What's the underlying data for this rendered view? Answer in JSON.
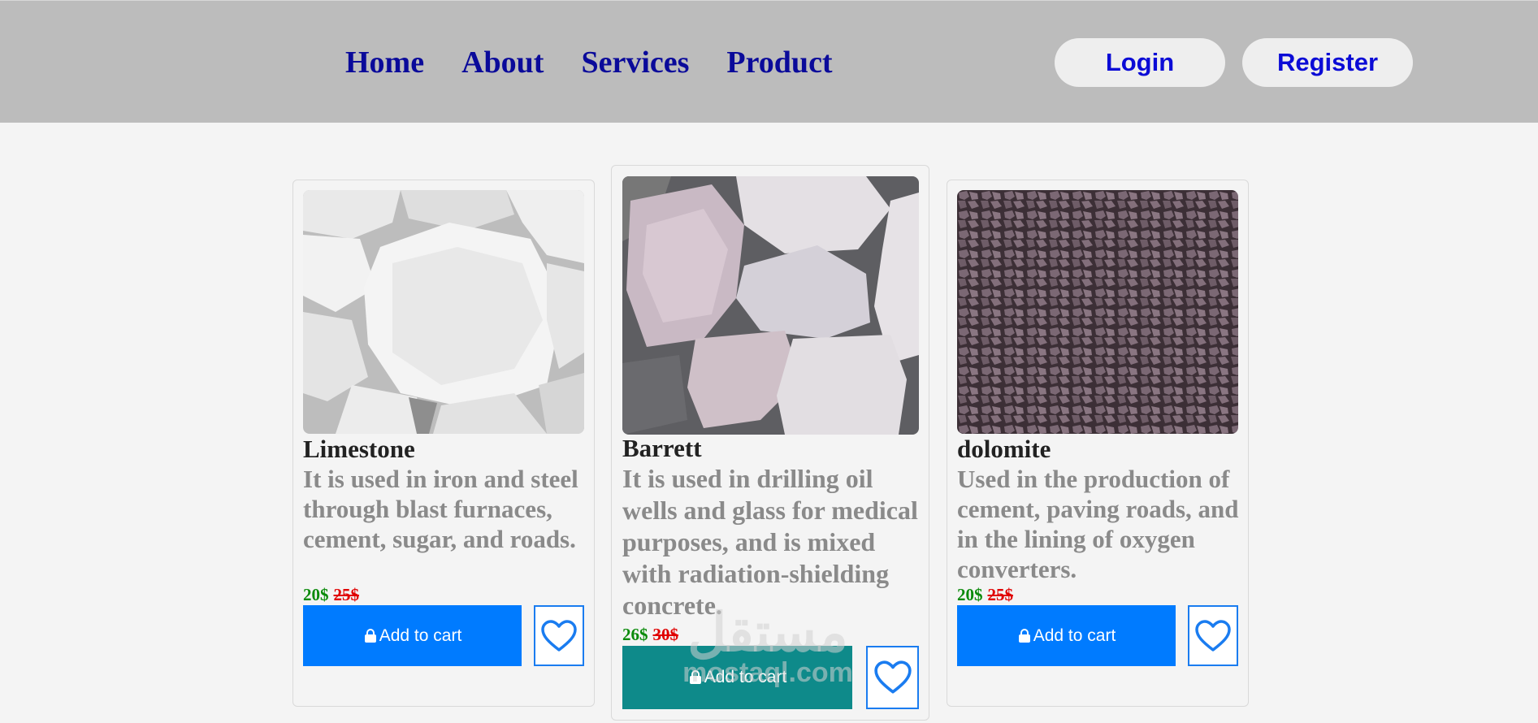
{
  "nav": {
    "items": [
      "Home",
      "About",
      "Services",
      "Product"
    ],
    "login_label": "Login",
    "register_label": "Register"
  },
  "colors": {
    "header_bg": "#bcbcbc",
    "nav_text": "#0a0a9a",
    "auth_text": "#0b0bd6",
    "cart_primary": "#007bff",
    "cart_hover": "#0e8a8a",
    "price_now": "#0a8a0a",
    "price_old": "#e00000"
  },
  "products": [
    {
      "name": "Limestone",
      "description": "It is used in iron and steel through blast furnaces, cement, sugar, and roads.",
      "price_now": "20$",
      "price_old": "25$",
      "cart_label": "Add to cart",
      "image": "white-limestone-rocks"
    },
    {
      "name": "Barrett",
      "description": "It is used in drilling oil wells and glass for medical purposes, and is mixed with radiation-shielding concrete.",
      "price_now": "26$",
      "price_old": "30$",
      "cart_label": "Add to cart",
      "image": "pink-barite-crystals"
    },
    {
      "name": "dolomite",
      "description": "Used in the production of cement, paving roads, and in the lining of oxygen converters.",
      "price_now": "20$",
      "price_old": "25$",
      "cart_label": "Add to cart",
      "image": "purple-brown-gravel"
    }
  ],
  "watermark": {
    "arabic": "مستقل",
    "latin": "mostaql.com"
  }
}
